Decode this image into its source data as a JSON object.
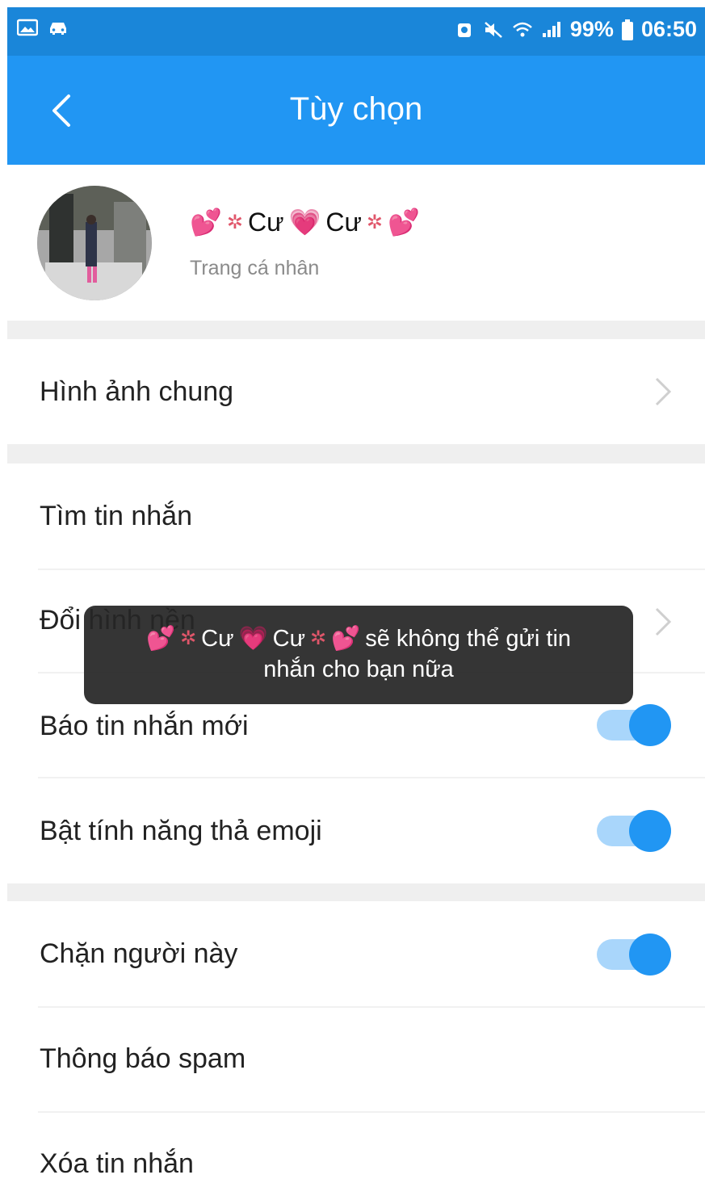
{
  "status_bar": {
    "battery": "99%",
    "time": "06:50"
  },
  "app_bar": {
    "title": "Tùy chọn"
  },
  "profile": {
    "name_parts": [
      "Cư",
      "Cư"
    ],
    "subtitle": "Trang cá nhân"
  },
  "menu": {
    "shared_media": "Hình ảnh chung",
    "search_messages": "Tìm tin nhắn",
    "change_wallpaper": "Đổi hình nền",
    "new_message_alert": "Báo tin nhắn mới",
    "emoji_reactions": "Bật tính năng thả emoji",
    "block_user": "Chặn người này",
    "report_spam": "Thông báo spam",
    "delete_messages": "Xóa tin nhắn"
  },
  "toggles": {
    "new_message_alert": true,
    "emoji_reactions": true,
    "block_user": true
  },
  "toast": {
    "name_a": "Cư",
    "name_b": "Cư",
    "text_after_name": "sẽ không thể gửi tin",
    "line2": "nhắn cho bạn nữa"
  },
  "colors": {
    "app_bar": "#2196f3",
    "status_bar": "#1a86d9",
    "toggle_on": "#2196f3"
  }
}
